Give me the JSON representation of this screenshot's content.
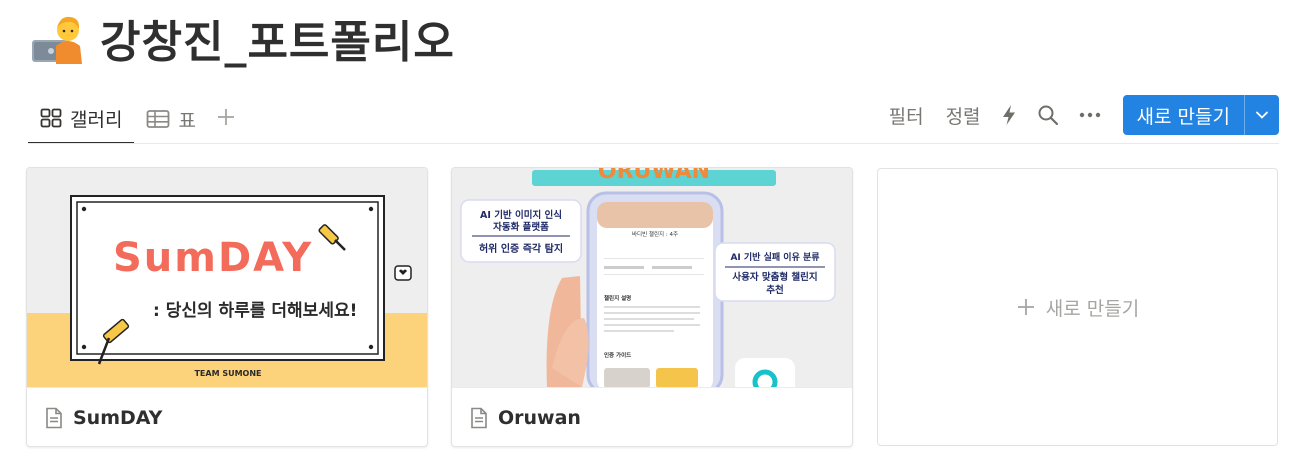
{
  "page": {
    "title": "강창진_포트폴리오",
    "icon": "technologist-emoji-icon"
  },
  "views": {
    "tabs": [
      {
        "label": "갤러리",
        "icon": "gallery-grid-icon",
        "active": true
      },
      {
        "label": "표",
        "icon": "table-icon",
        "active": false
      }
    ]
  },
  "toolbar": {
    "filter_label": "필터",
    "sort_label": "정렬",
    "automation_icon": "lightning-icon",
    "search_icon": "search-icon",
    "more_icon": "ellipsis-icon",
    "new_label": "새로 만들기",
    "new_color": "#2383e2"
  },
  "cards": [
    {
      "title": "SumDAY",
      "cover": {
        "headline": "SumDAY",
        "tagline": ": 당신의 하루를 더해보세요!",
        "team": "TEAM SUMONE",
        "band_color": "#fcd27b"
      }
    },
    {
      "title": "Oruwan",
      "cover": {
        "top_text": "ORUWAN",
        "callout1_line1": "AI 기반 이미지 인식",
        "callout1_line2": "자동화 플랫폼",
        "callout1_line3": "허위 인증 즉각 탐지",
        "callout2_line1": "AI 기반 실패 이유 분류",
        "callout2_line2": "사용자 맞춤형 챌린지",
        "callout2_line3": "추천",
        "phone_header": "바디빈 챌린지 : 4주",
        "phone_section1": "챌린지 설명",
        "phone_section2": "인증 가이드"
      }
    }
  ],
  "new_card_label": "새로 만들기"
}
